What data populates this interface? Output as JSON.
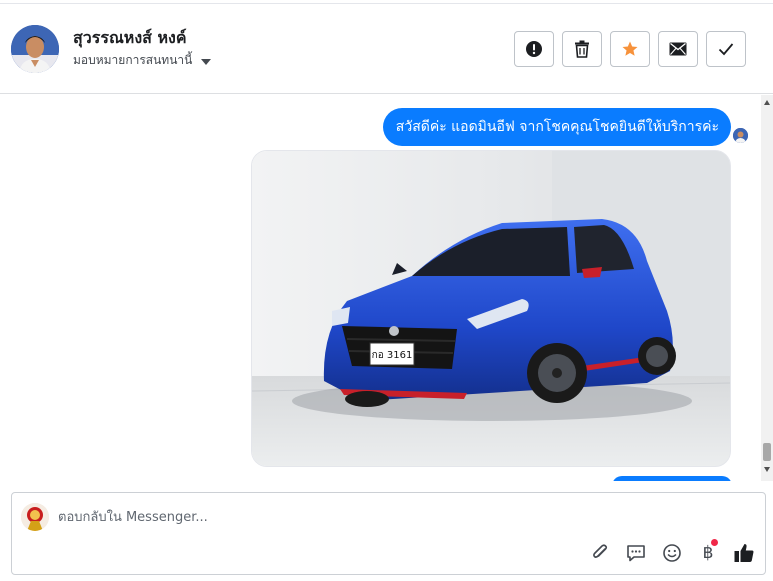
{
  "header": {
    "contact_name": "สุวรรณหงส์ หงค์",
    "assign_label": "มอบหมายการสนทนานี้",
    "actions": [
      {
        "name": "mark-spam-button",
        "icon": "exclamation-icon"
      },
      {
        "name": "delete-button",
        "icon": "trash-icon"
      },
      {
        "name": "star-button",
        "icon": "star-icon",
        "color": "#f7923b"
      },
      {
        "name": "mark-unread-button",
        "icon": "envelope-icon"
      },
      {
        "name": "mark-done-button",
        "icon": "check-icon"
      }
    ]
  },
  "thread": {
    "messages": [
      {
        "type": "text",
        "direction": "outgoing",
        "text": "สวัสดีค่ะ แอดมินอีฟ จากโชคคุณโชคยินดีให้บริการค่ะ"
      },
      {
        "type": "image",
        "direction": "outgoing",
        "subject": "blue hatchback car photo",
        "plate": "กอ 3161"
      }
    ],
    "bubble_color": "#0a7cff"
  },
  "composer": {
    "placeholder": "ตอบกลับใน Messenger...",
    "tools": [
      "paperclip-icon",
      "saved-reply-icon",
      "emoji-icon",
      "baht-payment-icon",
      "thumbs-up-icon"
    ],
    "baht_symbol": "฿"
  }
}
